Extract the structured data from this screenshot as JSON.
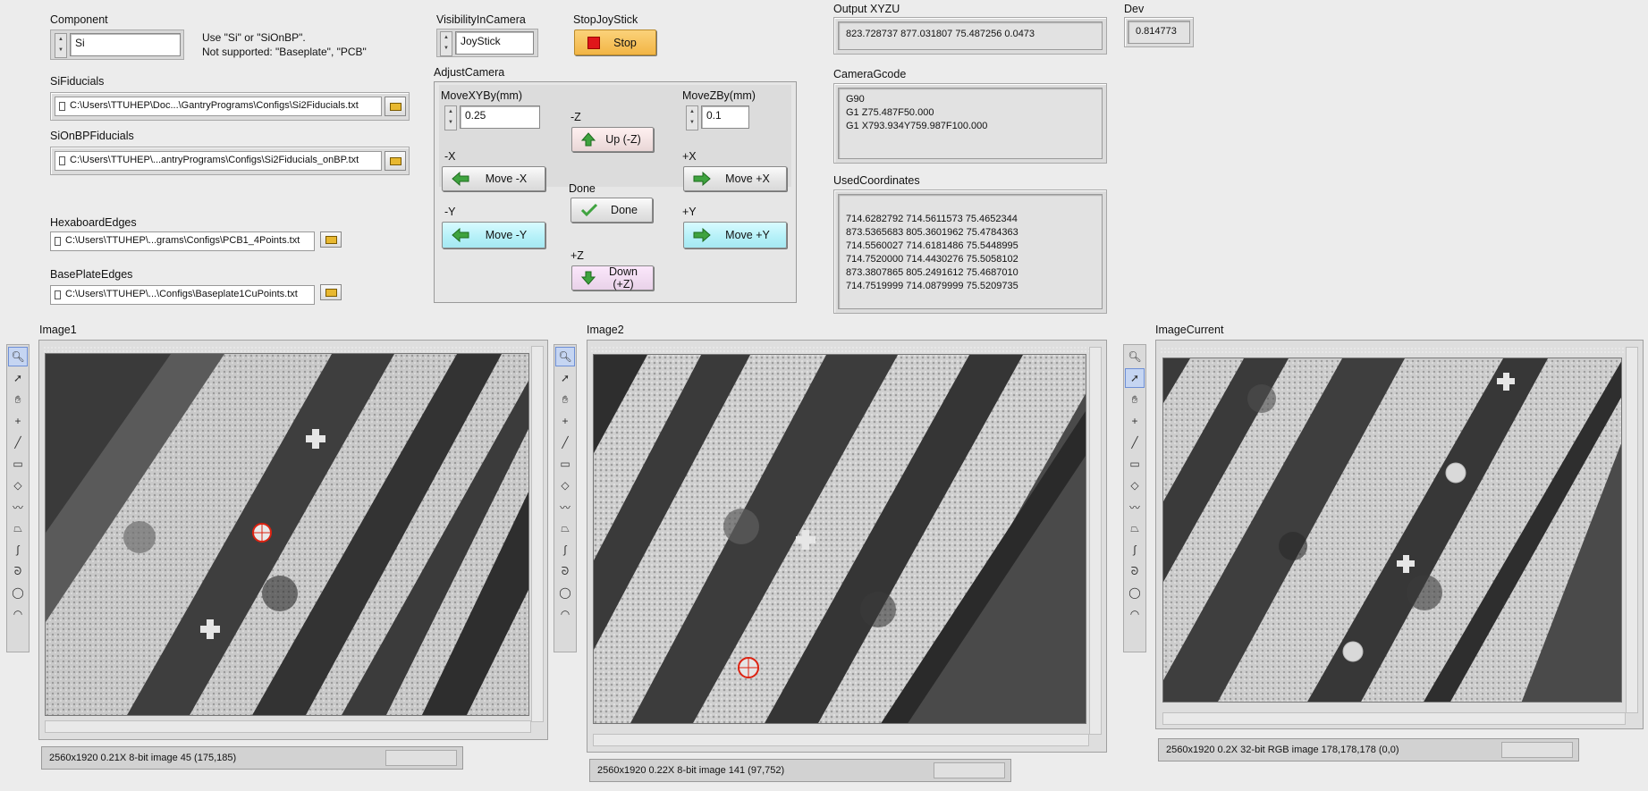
{
  "component": {
    "label": "Component",
    "value": "Si",
    "note1": "Use \"Si\" or \"SiOnBP\".",
    "note2": "Not supported: \"Baseplate\", \"PCB\""
  },
  "visibility": {
    "label": "VisibilityInCamera",
    "value": "JoyStick"
  },
  "stopjoystick": {
    "label": "StopJoyStick",
    "button": "Stop"
  },
  "output": {
    "label": "Output XYZU",
    "value": "823.728737 877.031807 75.487256 0.0473"
  },
  "dev": {
    "label": "Dev",
    "value": "0.814773"
  },
  "sifid": {
    "label": "SiFiducials",
    "path": "C:\\Users\\TTUHEP\\Doc...\\GantryPrograms\\Configs\\Si2Fiducials.txt"
  },
  "sionbp": {
    "label": "SiOnBPFiducials",
    "path": "C:\\Users\\TTUHEP\\...antryPrograms\\Configs\\Si2Fiducials_onBP.txt"
  },
  "hexa": {
    "label": "HexaboardEdges",
    "path": "C:\\Users\\TTUHEP\\...grams\\Configs\\PCB1_4Points.txt"
  },
  "baseplate": {
    "label": "BasePlateEdges",
    "path": "C:\\Users\\TTUHEP\\...\\Configs\\Baseplate1CuPoints.txt"
  },
  "adjust": {
    "label": "AdjustCamera",
    "movexy_label": "MoveXYBy(mm)",
    "movexy_value": "0.25",
    "movez_label": "MoveZBy(mm)",
    "movez_value": "0.1",
    "negz_label": "-Z",
    "up": "Up (-Z)",
    "negx_label": "-X",
    "move_negx": "Move  -X",
    "posx_label": "+X",
    "move_posx": "Move +X",
    "done_label": "Done",
    "done": "Done",
    "negy_label": "-Y",
    "move_negy": "Move  -Y",
    "posy_label": "+Y",
    "move_posy": "Move  +Y",
    "posz_label": "+Z",
    "down": "Down (+Z)"
  },
  "gcode": {
    "label": "CameraGcode",
    "lines": [
      "G90",
      "G1 Z75.487F50.000",
      "G1 X793.934Y759.987F100.000"
    ]
  },
  "used": {
    "label": "UsedCoordinates",
    "lines": [
      "714.6282792 714.5611573 75.4652344",
      "873.5365683 805.3601962 75.4784363",
      "714.5560027 714.6181486 75.5448995",
      "714.7520000 714.4430276 75.5058102",
      "873.3807865 805.2491612 75.4687010",
      "714.7519999 714.0879999 75.5209735"
    ]
  },
  "image1": {
    "label": "Image1",
    "status": "2560x1920 0.21X 8-bit image 45    (175,185)"
  },
  "image2": {
    "label": "Image2",
    "status": "2560x1920 0.22X 8-bit image 141    (97,752)"
  },
  "image3": {
    "label": "ImageCurrent",
    "status": "2560x1920 0.2X 32-bit RGB image 178,178,178    (0,0)"
  },
  "tools": [
    "zoom-icon",
    "pointer-icon",
    "pan-icon",
    "crosshair-icon",
    "line-icon",
    "rectangle-icon",
    "rotated-rect-icon",
    "polyline-icon",
    "polygon-icon",
    "freehand-line-icon",
    "freehand-region-icon",
    "oval-icon",
    "annulus-icon"
  ],
  "colors": {
    "stop_red": "#e0161a",
    "stop_bg": "#f6c25a",
    "cyan_btn": "#b4f0f8",
    "arrow_green": "#3fa33f"
  }
}
